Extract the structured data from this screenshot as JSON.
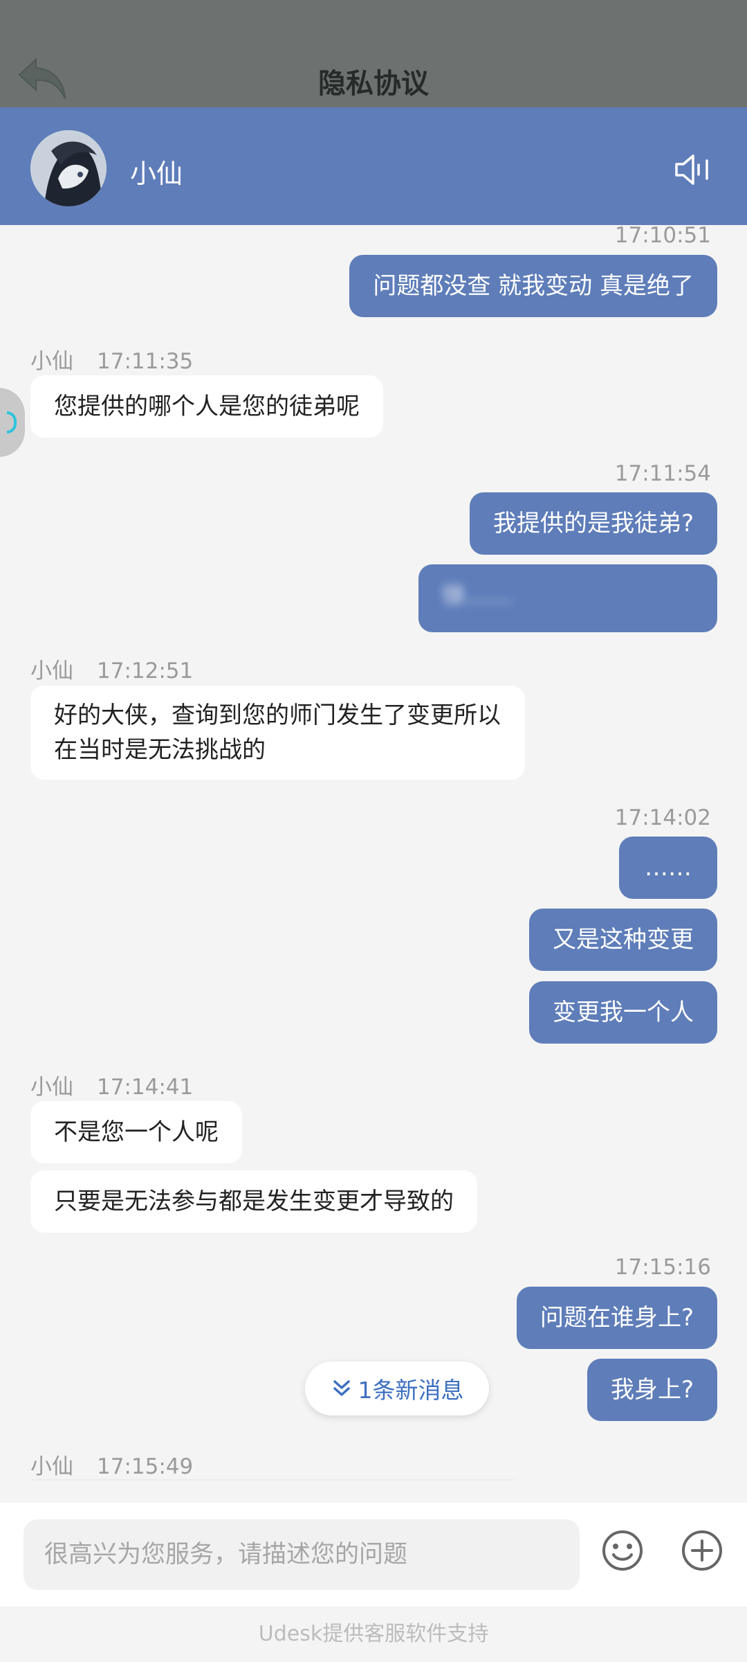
{
  "top_bar": {
    "title": "隐私协议",
    "back_icon": "back-arrow-icon"
  },
  "chat_header": {
    "agent_name": "小仙",
    "speaker_icon": "speaker-icon",
    "avatar_icon": "agent-avatar"
  },
  "messages": [
    {
      "time": "17:10:51",
      "text": "问题都没查 就我变动 真是绝了"
    },
    {
      "sender": "小仙",
      "time": "17:11:35",
      "text": "您提供的哪个人是您的徒弟呢"
    },
    {
      "time": "17:11:54",
      "text": "我提供的是我徒弟?",
      "blurred_text": "徐……"
    },
    {
      "sender": "小仙",
      "time": "17:12:51",
      "text": "好的大侠，查询到您的师门发生了变更所以在当时是无法挑战的"
    },
    {
      "time": "17:14:02",
      "texts": [
        "……",
        "又是这种变更",
        "变更我一个人"
      ]
    },
    {
      "sender": "小仙",
      "time": "17:14:41",
      "texts": [
        "不是您一个人呢",
        "只要是无法参与都是发生变更才导致的"
      ]
    },
    {
      "time": "17:15:16",
      "texts": [
        "问题在谁身上?",
        "我身上?"
      ]
    },
    {
      "sender": "小仙",
      "time": "17:15:49"
    }
  ],
  "new_message_pill": {
    "label": "1条新消息",
    "icon": "double-chevron-down-icon",
    "color": "#3d6fc0"
  },
  "composer": {
    "placeholder": "很高兴为您服务，请描述您的问题",
    "emoji_icon": "emoji-icon",
    "add_icon": "add-circle-icon"
  },
  "footer": {
    "text": "Udesk提供客服软件支持"
  },
  "colors": {
    "header": "#5e7db9",
    "top_bar": "#6d7270",
    "outgoing_bubble": "#5e7db9",
    "background": "#f4f4f4"
  }
}
